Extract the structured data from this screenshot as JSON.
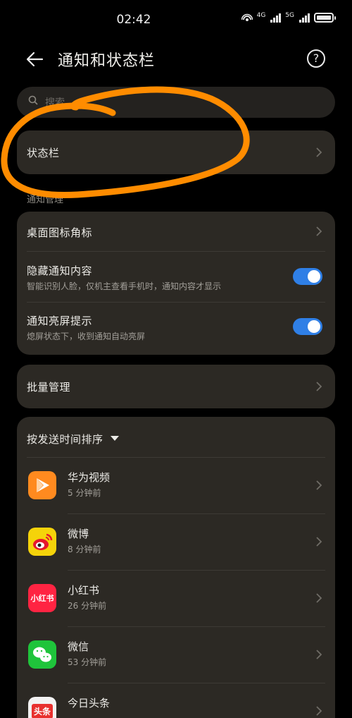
{
  "status_bar": {
    "time": "02:42",
    "signal1_label": "4G",
    "signal2_label": "5G"
  },
  "header": {
    "title": "通知和状态栏",
    "help_glyph": "?"
  },
  "search": {
    "placeholder": "搜索"
  },
  "status_bar_item": {
    "label": "状态栏"
  },
  "section": {
    "label": "通知管理"
  },
  "settings": {
    "badge_label": "桌面图标角标",
    "hide_content": {
      "label": "隐藏通知内容",
      "description": "智能识别人脸，仅机主查看手机时，通知内容才显示",
      "enabled": true
    },
    "wake_screen": {
      "label": "通知亮屏提示",
      "description": "熄屏状态下，收到通知自动亮屏",
      "enabled": true
    }
  },
  "batch": {
    "label": "批量管理"
  },
  "apps": {
    "sort_label": "按发送时间排序",
    "items": [
      {
        "name": "华为视频",
        "time": "5 分钟前",
        "icon": "huawei-video-icon",
        "color": "#ff8a1f"
      },
      {
        "name": "微博",
        "time": "8 分钟前",
        "icon": "weibo-icon",
        "color": "#f5d30a"
      },
      {
        "name": "小红书",
        "time": "26 分钟前",
        "icon": "xiaohongshu-icon",
        "color": "#ff2442",
        "icon_text": "小红书"
      },
      {
        "name": "微信",
        "time": "53 分钟前",
        "icon": "wechat-icon",
        "color": "#1fc43b"
      },
      {
        "name": "今日头条",
        "time": "",
        "icon": "toutiao-icon",
        "color": "#f2f2f2",
        "icon_text": "头条"
      }
    ]
  },
  "colors": {
    "card": "#2c2924",
    "toggle_on": "#2f7fe6",
    "annotation": "#ff8c00"
  }
}
